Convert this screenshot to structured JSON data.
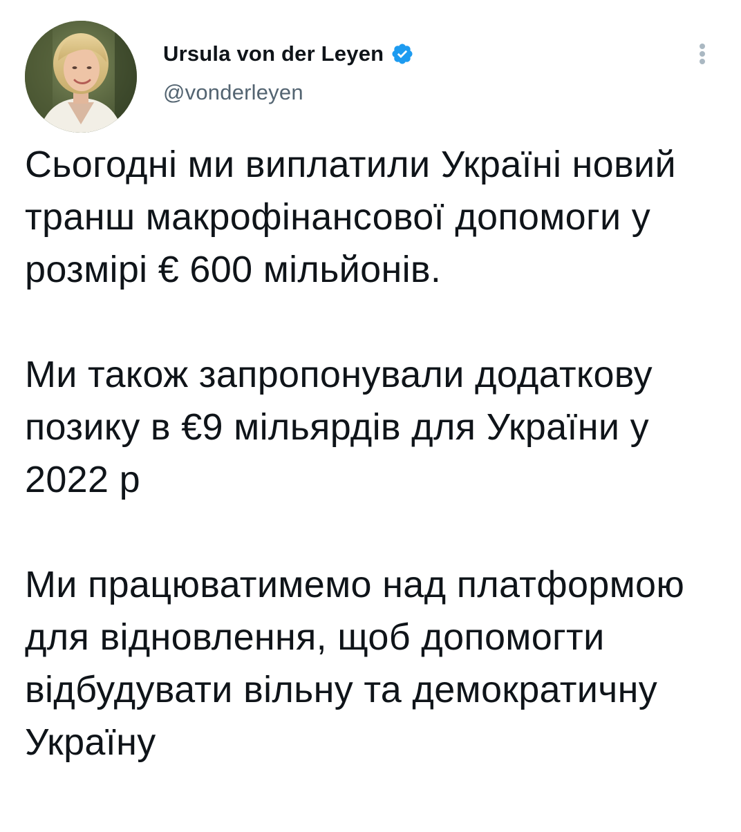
{
  "tweet": {
    "author": {
      "display_name": "Ursula von der Leyen",
      "handle": "@vonderleyen",
      "verified": true
    },
    "paragraphs": [
      "Сьогодні ми виплатили Україні новий транш макрофінансової допомоги у розмірі € 600 мільйонів.",
      "Ми також запропонували додаткову позику в €9 мільярдів для України у 2022 р",
      "Ми працюватимемо над платформою для відновлення, щоб допомогти відбудувати вільну та демократичну Україну"
    ]
  },
  "icons": {
    "verified": "verified-badge-icon",
    "more": "more-vertical-icon"
  },
  "colors": {
    "text": "#0f1419",
    "secondary_text": "#536471",
    "verified_blue": "#1d9bf0",
    "more_icon": "#aab8c2"
  }
}
